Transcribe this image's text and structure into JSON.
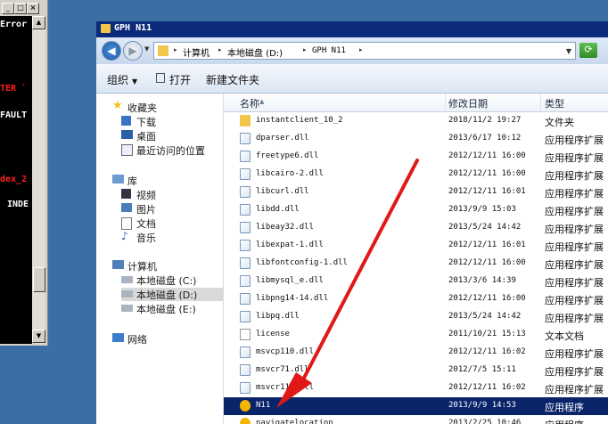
{
  "console": {
    "controls": [
      "_",
      "□",
      "×"
    ],
    "lines": [
      {
        "text": "Error",
        "color": "#ffffff"
      },
      {
        "text": "TER `",
        "color": "#ff2020"
      },
      {
        "text": "FAULT",
        "color": "#ffffff"
      },
      {
        "text": "dex_2",
        "color": "#ff2020"
      },
      {
        "text": "INDE",
        "color": "#ffffff"
      }
    ]
  },
  "window": {
    "title": "GPH N11"
  },
  "address": {
    "crumbs": [
      "计算机",
      "本地磁盘 (D:)",
      "GPH N11"
    ]
  },
  "toolbar": {
    "organize": "组织",
    "open": "打开",
    "new_folder": "新建文件夹"
  },
  "nav": {
    "favorites": "收藏夹",
    "downloads": "下载",
    "desktop": "桌面",
    "recent": "最近访问的位置",
    "libraries": "库",
    "videos": "视频",
    "pictures": "图片",
    "documents": "文档",
    "music": "音乐",
    "computer": "计算机",
    "drive_c": "本地磁盘 (C:)",
    "drive_d": "本地磁盘 (D:)",
    "drive_e": "本地磁盘 (E:)",
    "network": "网络"
  },
  "columns": {
    "name": "名称",
    "date": "修改日期",
    "type": "类型"
  },
  "files": [
    {
      "name": "instantclient_10_2",
      "date": "2018/11/2 19:27",
      "type": "文件夹",
      "icon": "folder-icon"
    },
    {
      "name": "dparser.dll",
      "date": "2013/6/17 10:12",
      "type": "应用程序扩展",
      "icon": "dll-icon"
    },
    {
      "name": "freetype6.dll",
      "date": "2012/12/11 16:00",
      "type": "应用程序扩展",
      "icon": "dll-icon"
    },
    {
      "name": "libcairo-2.dll",
      "date": "2012/12/11 16:00",
      "type": "应用程序扩展",
      "icon": "dll-icon"
    },
    {
      "name": "libcurl.dll",
      "date": "2012/12/11 16:01",
      "type": "应用程序扩展",
      "icon": "dll-icon"
    },
    {
      "name": "libdd.dll",
      "date": "2013/9/9 15:03",
      "type": "应用程序扩展",
      "icon": "dll-icon"
    },
    {
      "name": "libeay32.dll",
      "date": "2013/5/24 14:42",
      "type": "应用程序扩展",
      "icon": "dll-icon"
    },
    {
      "name": "libexpat-1.dll",
      "date": "2012/12/11 16:01",
      "type": "应用程序扩展",
      "icon": "dll-icon"
    },
    {
      "name": "libfontconfig-1.dll",
      "date": "2012/12/11 16:00",
      "type": "应用程序扩展",
      "icon": "dll-icon"
    },
    {
      "name": "libmysql_e.dll",
      "date": "2013/3/6 14:39",
      "type": "应用程序扩展",
      "icon": "dll-icon"
    },
    {
      "name": "libpng14-14.dll",
      "date": "2012/12/11 16:00",
      "type": "应用程序扩展",
      "icon": "dll-icon"
    },
    {
      "name": "libpq.dll",
      "date": "2013/5/24 14:42",
      "type": "应用程序扩展",
      "icon": "dll-icon"
    },
    {
      "name": "license",
      "date": "2011/10/21 15:13",
      "type": "文本文档",
      "icon": "text-file-icon"
    },
    {
      "name": "msvcp110.dll",
      "date": "2012/12/11 16:02",
      "type": "应用程序扩展",
      "icon": "dll-icon"
    },
    {
      "name": "msvcr71.dll",
      "date": "2012/7/5 15:11",
      "type": "应用程序扩展",
      "icon": "dll-icon"
    },
    {
      "name": "msvcr110.dll",
      "date": "2012/12/11 16:02",
      "type": "应用程序扩展",
      "icon": "dll-icon"
    },
    {
      "name": "N11",
      "date": "2013/9/9 14:53",
      "type": "应用程序",
      "icon": "exe-icon",
      "selected": true
    },
    {
      "name": "navigatelocation",
      "date": "2013/2/25 10:46",
      "type": "应用程序",
      "icon": "exe-icon"
    }
  ]
}
